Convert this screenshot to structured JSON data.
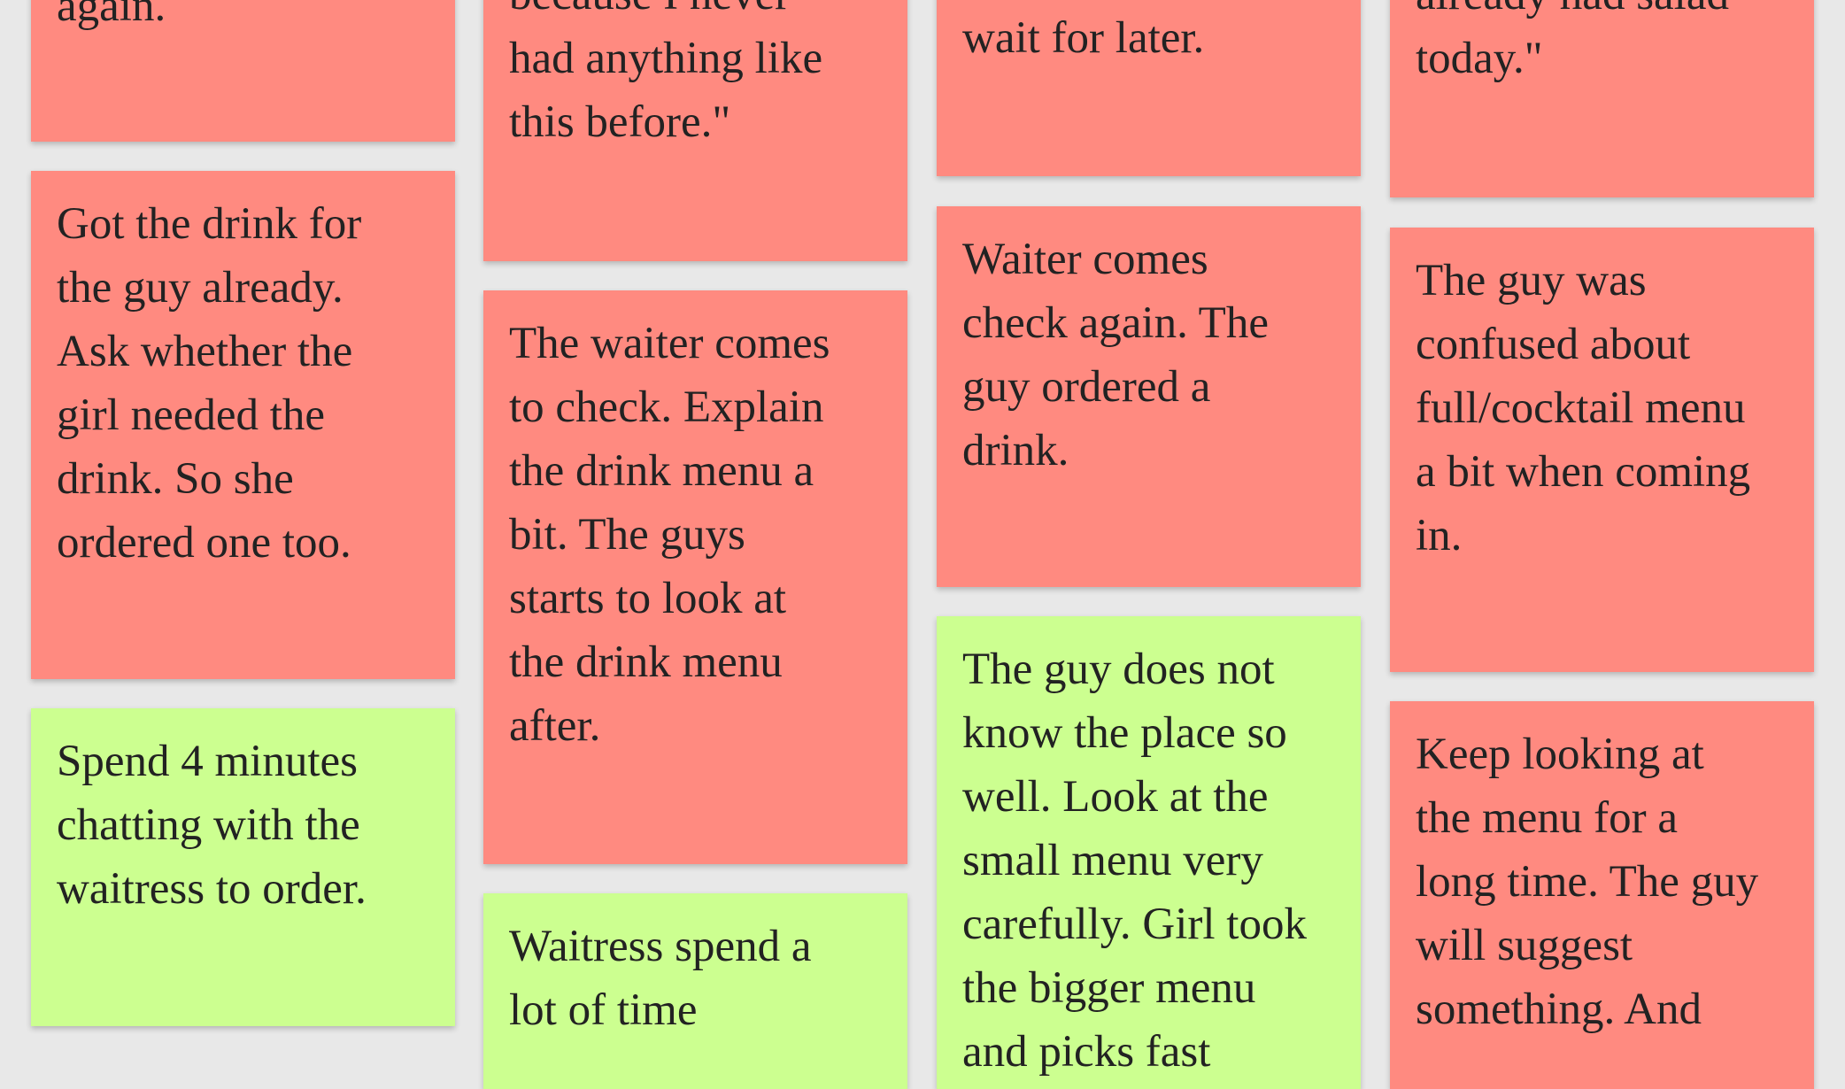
{
  "colors": {
    "background": "#e8e8e8",
    "problem_note": "#ff8a80",
    "positive_note": "#ccff90"
  },
  "columns": [
    [
      {
        "color": "red",
        "lines": [
          "again."
        ]
      },
      {
        "color": "red",
        "lines": [
          "Got the drink for",
          "the guy already.",
          "Ask whether the",
          "girl needed the",
          "drink. So she",
          "ordered one too."
        ]
      },
      {
        "color": "green",
        "lines": [
          "Spend 4 minutes",
          "chatting with the",
          "waitress to order."
        ]
      }
    ],
    [
      {
        "color": "red",
        "lines": [
          "because I never",
          "had anything like",
          "this before.\""
        ]
      },
      {
        "color": "red",
        "lines": [
          "The waiter comes",
          "to check. Explain",
          "the drink menu a",
          "bit. The guys",
          "starts to look at",
          "the drink menu",
          "after."
        ]
      },
      {
        "color": "green",
        "lines": [
          "Waitress spend a",
          "lot of time"
        ]
      }
    ],
    [
      {
        "color": "red",
        "lines": [
          "wait for later."
        ]
      },
      {
        "color": "red",
        "lines": [
          "Waiter comes",
          "check again. The",
          "guy ordered a",
          "drink."
        ]
      },
      {
        "color": "green",
        "lines": [
          "The guy does not",
          "know the place so",
          "well. Look at the",
          "small menu very",
          "carefully. Girl took",
          "the bigger menu",
          "and picks fast"
        ]
      }
    ],
    [
      {
        "color": "red",
        "lines": [
          "already had salad",
          "today.\""
        ]
      },
      {
        "color": "red",
        "lines": [
          "The guy was",
          "confused about",
          "full/cocktail menu",
          "a bit when coming",
          "in."
        ]
      },
      {
        "color": "red",
        "lines": [
          "Keep looking at",
          "the menu for a",
          "long time. The guy",
          "will suggest",
          "something. And"
        ]
      }
    ]
  ]
}
